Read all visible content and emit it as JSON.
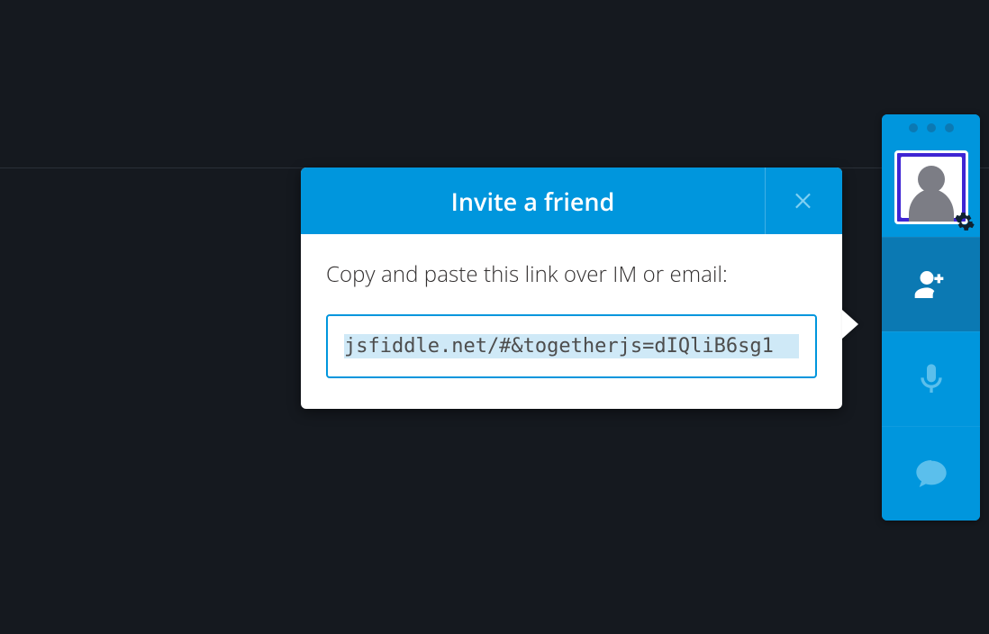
{
  "modal": {
    "title": "Invite a friend",
    "hint": "Copy and paste this link over IM or email:",
    "share_url": "jsfiddle.net/#&togetherjs=dIQliB6sg1"
  },
  "dock": {
    "items": {
      "invite": "Invite friend",
      "audio": "Voice chat",
      "chat": "Text chat"
    }
  }
}
